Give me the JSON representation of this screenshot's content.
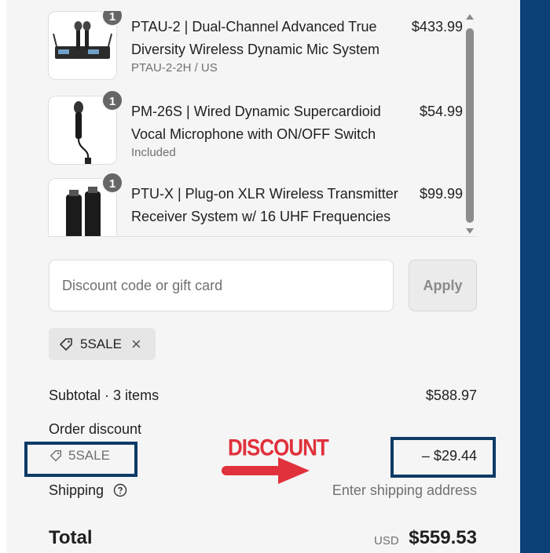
{
  "cart": {
    "items": [
      {
        "quantity": "1",
        "title": "PTAU-2 | Dual-Channel Advanced True Diversity Wireless Dynamic Mic System",
        "variant": "PTAU-2-2H / US",
        "price": "$433.99"
      },
      {
        "quantity": "1",
        "title": "PM-26S | Wired Dynamic Supercardioid Vocal Microphone with ON/OFF Switch",
        "variant": "Included",
        "price": "$54.99"
      },
      {
        "quantity": "1",
        "title": "PTU-X | Plug-on XLR Wireless Transmitter Receiver System w/ 16 UHF Frequencies",
        "variant": "",
        "price": "$99.99"
      }
    ]
  },
  "discount": {
    "placeholder": "Discount code or gift card",
    "value": "",
    "apply_label": "Apply",
    "applied_code": "5SALE"
  },
  "summary": {
    "subtotal_label": "Subtotal · 3 items",
    "subtotal_value": "$588.97",
    "order_discount_label": "Order discount",
    "discount_code": "5SALE",
    "discount_value": "– $29.44",
    "shipping_label": "Shipping",
    "shipping_value": "Enter shipping address",
    "total_label": "Total",
    "currency": "USD",
    "total_value": "$559.53"
  },
  "annotation": {
    "label": "DISCOUNT",
    "color": "#e0313c",
    "box_color": "#0e3b66"
  },
  "colors": {
    "panel_bg": "#f5f5f5",
    "right_bar": "#0b4177",
    "badge": "#666666"
  }
}
